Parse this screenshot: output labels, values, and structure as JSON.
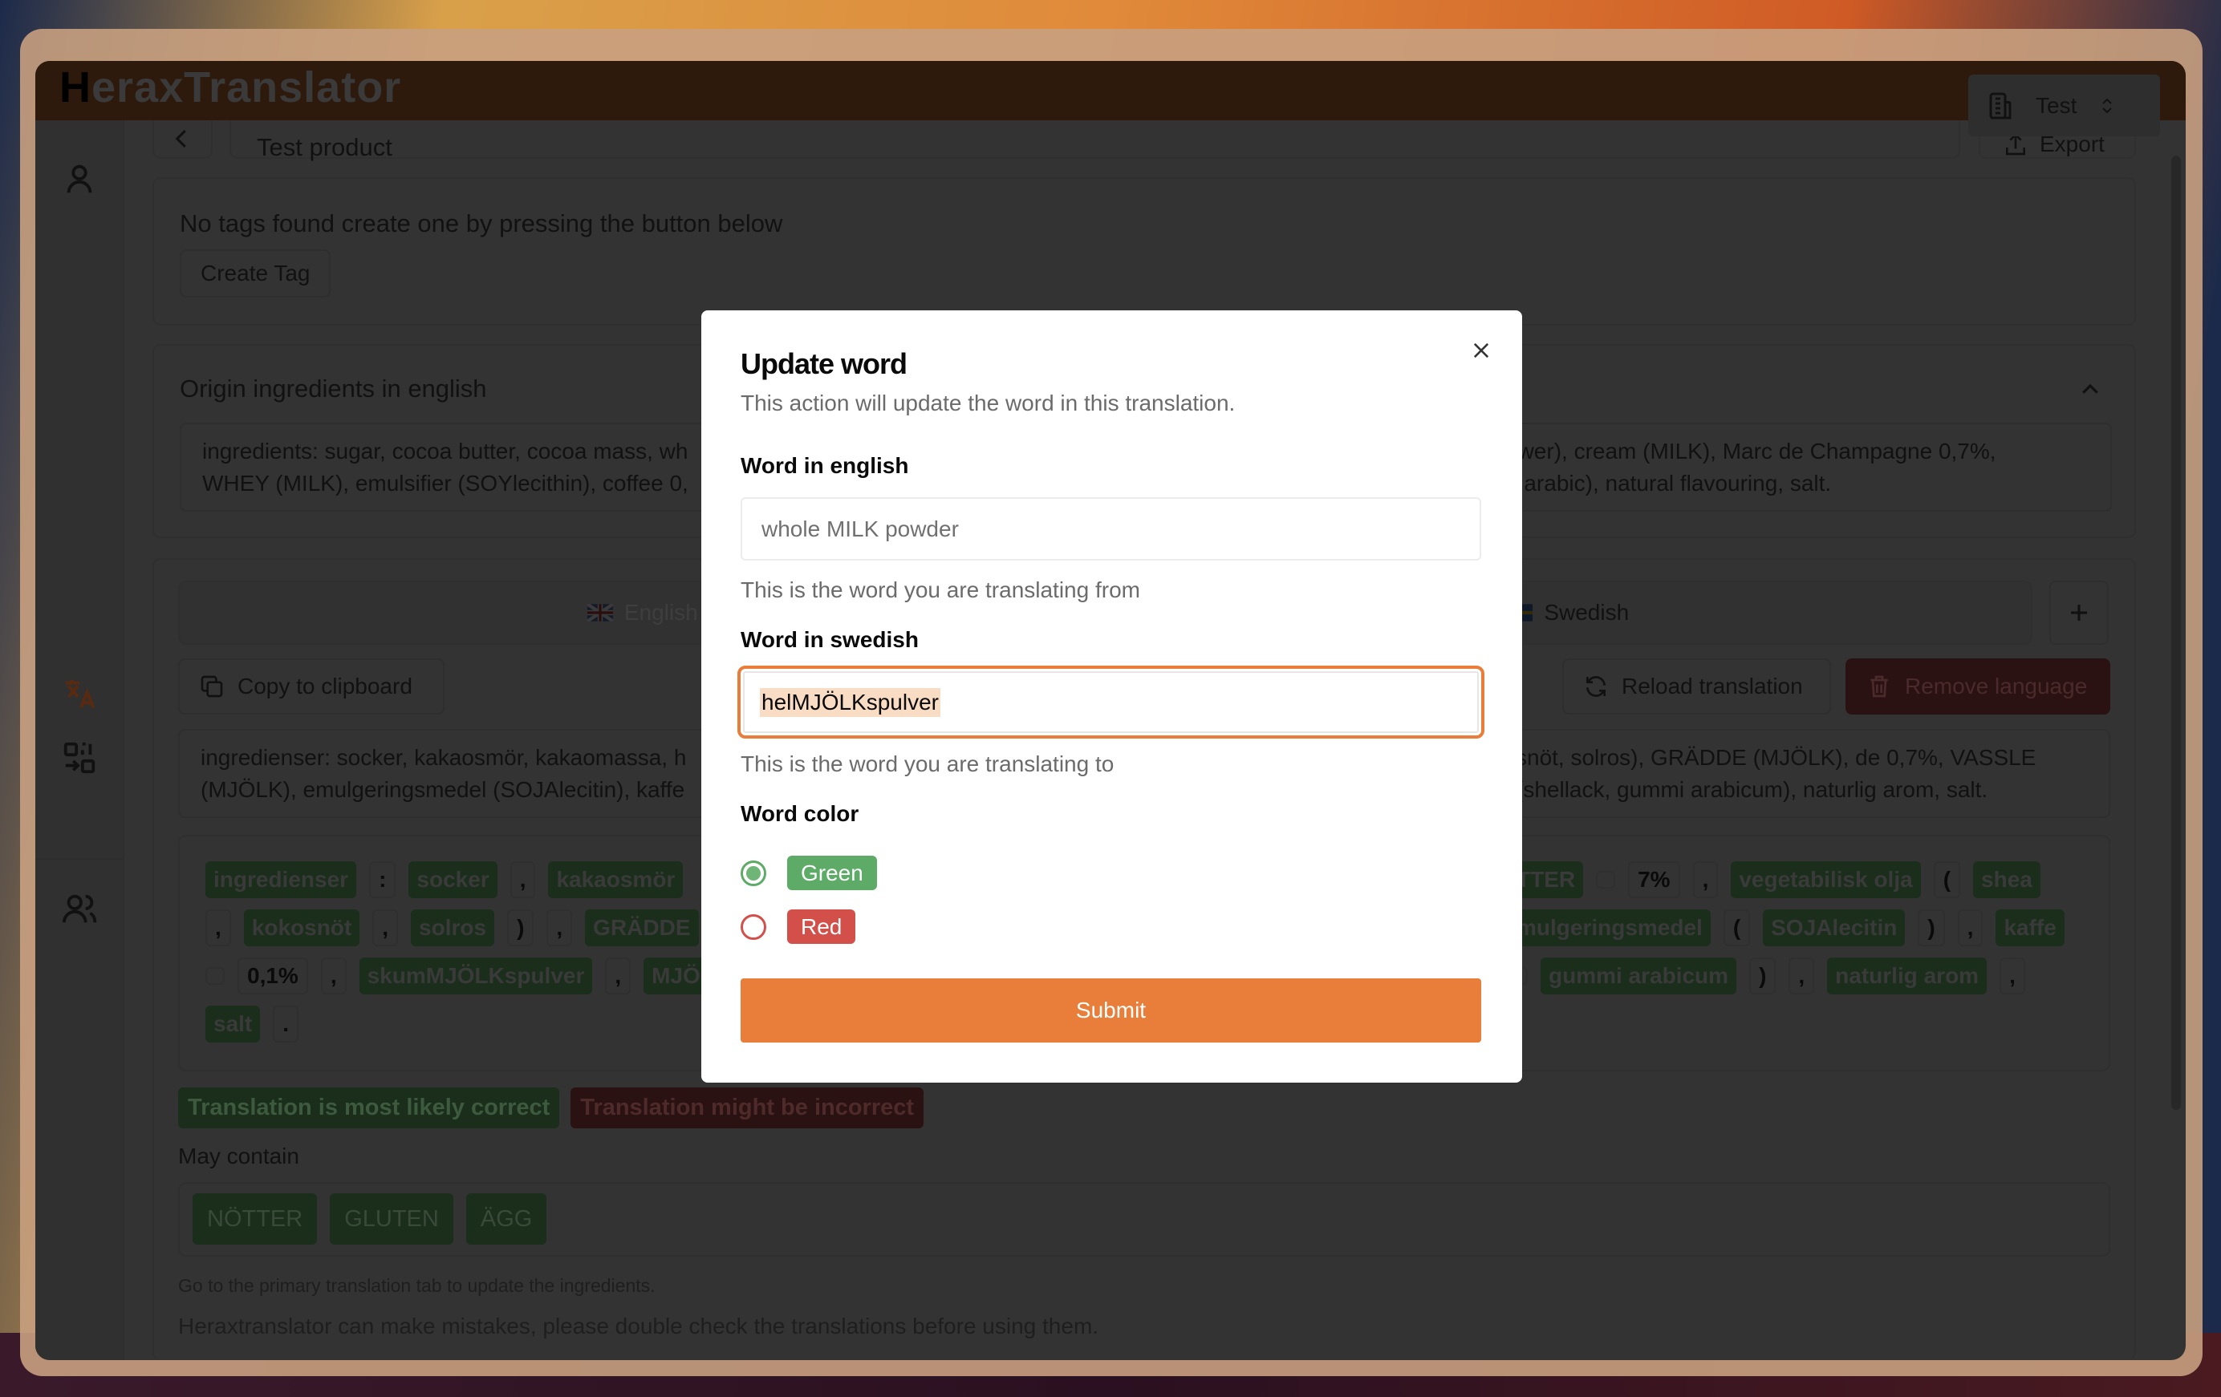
{
  "app": {
    "logo": "HeraxTranslator",
    "logo_first": "H",
    "logo_rest": "eraxTranslator"
  },
  "header": {
    "org_name": "Test"
  },
  "page": {
    "title": "Test product",
    "export_label": "Export"
  },
  "tags": {
    "empty_text": "No tags found create one by pressing the button below",
    "create_label": "Create Tag"
  },
  "origin": {
    "title": "Origin ingredients in english",
    "text_left_1": "ingredients: sugar, cocoa butter, cocoa mass, wh",
    "text_left_2": "WHEY (MILK), emulsifier (SOYlecithin), coffee 0,",
    "text_right_1": "ower), cream (MILK), Marc de Champagne 0,7%,",
    "text_right_2": "n arabic), natural flavouring, salt."
  },
  "tabs": [
    {
      "label": "English",
      "flag": "uk-flag"
    },
    {
      "label": "Swedish",
      "flag": "sweden-flag"
    }
  ],
  "actions": {
    "copy": "Copy to clipboard",
    "reload": "Reload translation",
    "remove": "Remove language"
  },
  "translation": {
    "text_left_1": "ingredienser: socker, kakaosmör, kakaomassa, h",
    "text_left_2": "(MJÖLK), emulgeringsmedel (SOJAlecitin), kaffe",
    "text_right_1": "snöt, solros), GRÄDDE (MJÖLK), de 0,7%, VASSLE",
    "text_right_2": "(shellack, gummi arabicum), naturlig arom, salt."
  },
  "chips": {
    "left": [
      [
        {
          "t": "ingredienser",
          "k": "g"
        },
        {
          "t": ":",
          "k": "p"
        },
        {
          "t": "socker",
          "k": "g"
        },
        {
          "t": ",",
          "k": "p"
        },
        {
          "t": "kakaosmör",
          "k": "g"
        }
      ],
      [
        {
          "t": ",",
          "k": "p"
        },
        {
          "t": "kokosnöt",
          "k": "g"
        },
        {
          "t": ",",
          "k": "p"
        },
        {
          "t": "solros",
          "k": "g"
        },
        {
          "t": ")",
          "k": "p"
        },
        {
          "t": ",",
          "k": "p"
        },
        {
          "t": "GRÄDDE",
          "k": "g"
        }
      ],
      [
        {
          "t": "",
          "k": "p"
        },
        {
          "t": "0,1%",
          "k": "p"
        },
        {
          "t": ",",
          "k": "p"
        },
        {
          "t": "skumMJÖLKspulver",
          "k": "g"
        },
        {
          "t": ",",
          "k": "p"
        },
        {
          "t": "MJÖLK",
          "k": "g"
        }
      ],
      [
        {
          "t": "salt",
          "k": "g"
        },
        {
          "t": ".",
          "k": "p"
        }
      ]
    ],
    "right": [
      [
        {
          "t": "TTER",
          "k": "g"
        },
        {
          "t": "",
          "k": "p"
        },
        {
          "t": "7%",
          "k": "p"
        },
        {
          "t": ",",
          "k": "p"
        },
        {
          "t": "vegetabilisk olja",
          "k": "g"
        },
        {
          "t": "(",
          "k": "p"
        },
        {
          "t": "shea",
          "k": "g"
        }
      ],
      [
        {
          "t": "mulgeringsmedel",
          "k": "g"
        },
        {
          "t": "(",
          "k": "p"
        },
        {
          "t": "SOJAlecitin",
          "k": "g"
        },
        {
          "t": ")",
          "k": "p"
        },
        {
          "t": ",",
          "k": "p"
        },
        {
          "t": "kaffe",
          "k": "g"
        }
      ],
      [
        {
          "t": "",
          "k": "p"
        },
        {
          "t": "gummi arabicum",
          "k": "g"
        },
        {
          "t": ")",
          "k": "p"
        },
        {
          "t": ",",
          "k": "p"
        },
        {
          "t": "naturlig arom",
          "k": "g"
        },
        {
          "t": ",",
          "k": "p"
        }
      ]
    ]
  },
  "legend": {
    "correct": "Translation is most likely correct",
    "incorrect": "Translation might be incorrect"
  },
  "may_contain": {
    "title": "May contain",
    "items": [
      "NÖTTER",
      "GLUTEN",
      "ÄGG"
    ]
  },
  "footer": {
    "note": "Go to the primary translation tab to update the ingredients.",
    "disclaimer": "Heraxtranslator can make mistakes, please double check the translations before using them."
  },
  "modal": {
    "title": "Update word",
    "description": "This action will update the word in this translation.",
    "english_label": "Word in english",
    "english_value": "whole MILK powder",
    "english_help": "This is the word you are translating from",
    "swedish_label": "Word in swedish",
    "swedish_value": "helMJÖLKspulver",
    "swedish_help": "This is the word you are translating to",
    "color_label": "Word color",
    "colors": [
      {
        "label": "Green",
        "selected": true,
        "hex": "#5dab67"
      },
      {
        "label": "Red",
        "selected": false,
        "hex": "#d34f4a"
      }
    ],
    "submit": "Submit"
  },
  "colors": {
    "accent": "#e87e3a",
    "green": "#5dab67",
    "red": "#d34f4a"
  }
}
